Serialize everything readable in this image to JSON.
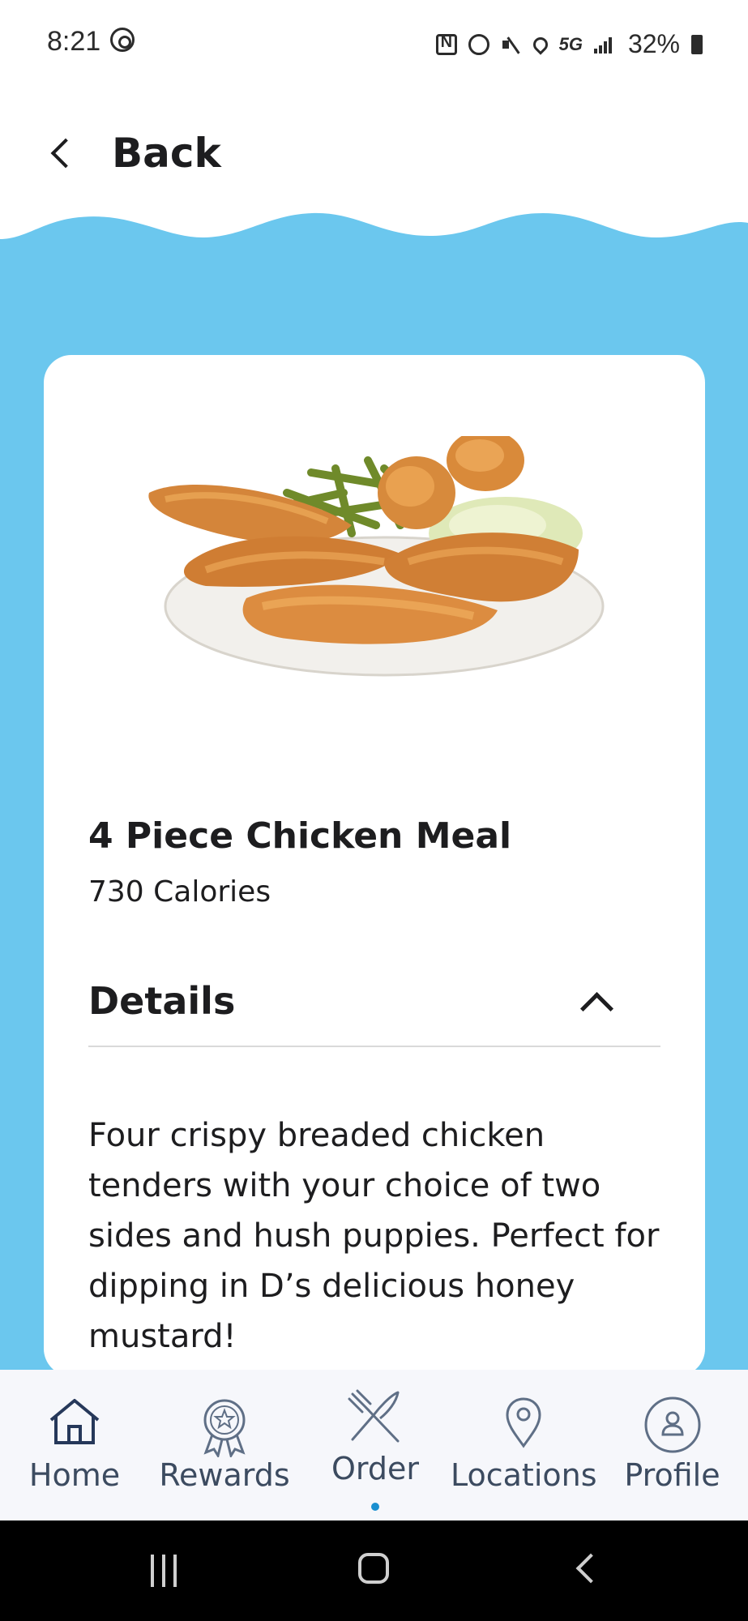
{
  "status_bar": {
    "time": "8:21",
    "network": "5G",
    "battery": "32%"
  },
  "header": {
    "back_label": "Back"
  },
  "colors": {
    "accent_blue": "#6bc7ee",
    "nav_text": "#3c4b60",
    "active_dot": "#1a8fd0"
  },
  "item": {
    "title": "4 Piece Chicken Meal",
    "calories": "730 Calories",
    "details_label": "Details",
    "details_text": "Four crispy breaded chicken tenders with your choice of two sides and hush puppies. Perfect for dipping in D’s delicious honey mustard!"
  },
  "bottom_nav": {
    "items": [
      {
        "label": "Home",
        "icon": "home-icon"
      },
      {
        "label": "Rewards",
        "icon": "rewards-badge-icon"
      },
      {
        "label": "Order",
        "icon": "fork-knife-icon",
        "active": true
      },
      {
        "label": "Locations",
        "icon": "location-pin-icon"
      },
      {
        "label": "Profile",
        "icon": "profile-icon"
      }
    ]
  }
}
